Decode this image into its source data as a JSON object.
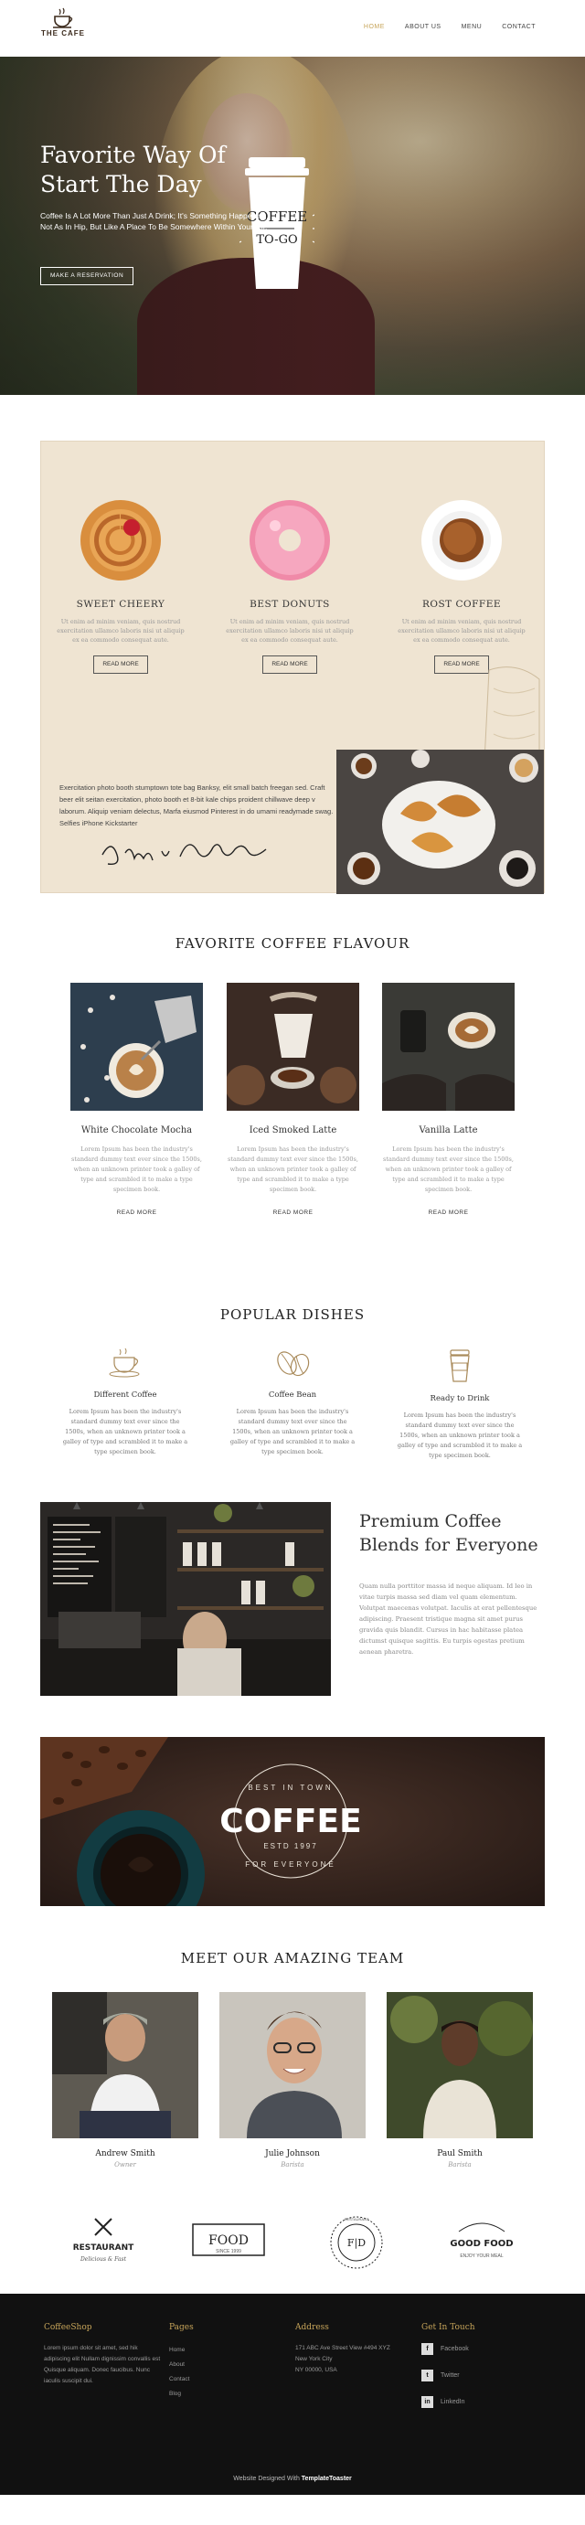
{
  "nav": {
    "logo_text": "THE CAFE",
    "items": [
      {
        "label": "HOME",
        "active": true
      },
      {
        "label": "ABOUT US",
        "active": false
      },
      {
        "label": "MENU",
        "active": false
      },
      {
        "label": "CONTACT",
        "active": false
      }
    ]
  },
  "hero": {
    "title": "Favorite Way Of Start The Day",
    "text": "Coffee Is A Lot More Than Just A Drink; It's Something Happening. Not As In Hip, But Like A Place To Be Somewhere Within Yourself.",
    "button": "MAKE A RESERVATION"
  },
  "featured": {
    "items": [
      {
        "title": "SWEET CHEERY",
        "text": "Ut enim ad minim veniam, quis nostrud exercitation ullamco laboris nisi ut aliquip ex ea commodo consequat aute.",
        "button": "READ MORE"
      },
      {
        "title": "BEST DONUTS",
        "text": "Ut enim ad minim veniam, quis nostrud exercitation ullamco laboris nisi ut aliquip ex ea commodo consequat aute.",
        "button": "READ MORE"
      },
      {
        "title": "ROST COFFEE",
        "text": "Ut enim ad minim veniam, quis nostrud exercitation ullamco laboris nisi ut aliquip ex ea commodo consequat aute.",
        "button": "READ MORE"
      }
    ],
    "quote": "Exercitation photo booth stumptown tote bag Banksy, elit small batch freegan sed. Craft beer elit seitan exercitation, photo booth et 8-bit kale chips proident chillwave deep v laborum. Aliquip veniam delectus, Marfa eiusmod Pinterest in do umami readymade swag. Selfies iPhone Kickstarter",
    "signature": "James Arthur"
  },
  "flavours": {
    "title": "FAVORITE COFFEE FLAVOUR",
    "items": [
      {
        "title": "White Chocolate Mocha",
        "text": "Lorem Ipsum has been the industry's standard dummy text ever since the 1500s, when an unknown printer took a galley of type and scrambled it to make a type specimen book.",
        "link": "READ MORE"
      },
      {
        "title": "Iced Smoked Latte",
        "text": "Lorem Ipsum has been the industry's standard dummy text ever since the 1500s, when an unknown printer took a galley of type and scrambled it to make a type specimen book.",
        "link": "READ MORE"
      },
      {
        "title": "Vanilla Latte",
        "text": "Lorem Ipsum has been the industry's standard dummy text ever since the 1500s, when an unknown printer took a galley of type and scrambled it to make a type specimen book.",
        "link": "READ MORE"
      }
    ]
  },
  "dishes": {
    "title": "POPULAR DISHES",
    "items": [
      {
        "title": "Different Coffee",
        "icon": "coffee-cup-icon",
        "text": "Lorem Ipsum has been the industry's standard dummy text ever since the 1500s, when an unknown printer took a galley of type and scrambled it to make a type specimen book."
      },
      {
        "title": "Coffee Bean",
        "icon": "coffee-bean-icon",
        "text": "Lorem Ipsum has been the industry's standard dummy text ever since the 1500s, when an unknown printer took a galley of type and scrambled it to make a type specimen book."
      },
      {
        "title": "Ready to Drink",
        "icon": "takeaway-cup-icon",
        "text": "Lorem Ipsum has been the industry's standard dummy text ever since the 1500s, when an unknown printer took a galley of type and scrambled it to make a type specimen book."
      }
    ]
  },
  "premium": {
    "title": "Premium Coffee Blends for Everyone",
    "text": "Quam nulla porttitor massa id neque aliquam. Id leo in vitae turpis massa sed diam vel quam elementum. Volutpat maecenas volutpat. Iaculis at erat pellentesque adipiscing. Praesent tristique magna sit amet purus gravida quis blandit. Cursus in hac habitasse platea dictumst quisque sagittis. Eu turpis egestas pretium aenean pharetra."
  },
  "banner": {
    "top_text": "BEST IN TOWN",
    "main_text": "COFFEE",
    "est_text": "ESTD 1997",
    "bottom_text": "FOR EVERYONE"
  },
  "team": {
    "title": "MEET OUR AMAZING TEAM",
    "members": [
      {
        "name": "Andrew Smith",
        "role": "Owner"
      },
      {
        "name": "Julie Johnson",
        "role": "Barista"
      },
      {
        "name": "Paul Smith",
        "role": "Barista"
      }
    ]
  },
  "brands": [
    {
      "name": "RESTAURANT",
      "sub": "Delicious & Fast"
    },
    {
      "name": "FOOD",
      "sub": "SINCE 1999"
    },
    {
      "name": "F|D",
      "sub": "RESTAURANT"
    },
    {
      "name": "GOOD FOOD",
      "sub": "ENJOY YOUR MEAL"
    }
  ],
  "footer": {
    "col1": {
      "title": "CoffeeShop",
      "text": "Lorem ipsum dolor sit amet, sed hik adipiscing elit Nullam dignissim convallis est Quisque aliquam. Donec faucibus. Nunc iaculis suscipit dui."
    },
    "col2": {
      "title": "Pages",
      "links": [
        "Home",
        "About",
        "Contact",
        "Blog"
      ]
    },
    "col3": {
      "title": "Address",
      "lines": [
        "171 ABC Ave Street View #494 XYZ",
        "New York City",
        "NY 00000, USA"
      ]
    },
    "col4": {
      "title": "Get In Touch",
      "social": [
        {
          "glyph": "f",
          "label": "Facebook"
        },
        {
          "glyph": "t",
          "label": "Twitter"
        },
        {
          "glyph": "in",
          "label": "LinkedIn"
        }
      ]
    },
    "copyright_prefix": "Website Designed With",
    "copyright_brand": "TemplateToaster"
  },
  "colors": {
    "accent": "#c7a55a",
    "feature_bg": "#efe4d2",
    "footer_bg": "#111111"
  }
}
